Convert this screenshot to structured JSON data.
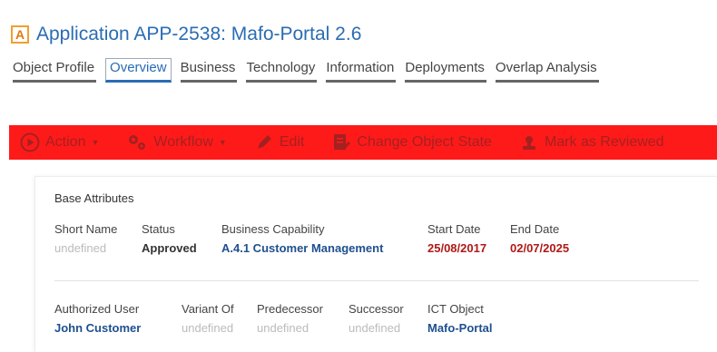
{
  "header": {
    "badge": "A",
    "title": "Application APP-2538: Mafo-Portal 2.6"
  },
  "tabs": [
    {
      "label": "Object Profile"
    },
    {
      "label": "Overview"
    },
    {
      "label": "Business"
    },
    {
      "label": "Technology"
    },
    {
      "label": "Information"
    },
    {
      "label": "Deployments"
    },
    {
      "label": "Overlap Analysis"
    }
  ],
  "toolbar": {
    "background": "#ff1a1a",
    "items": [
      {
        "label": "Action",
        "icon": "play-circle-icon"
      },
      {
        "label": "Workflow",
        "icon": "gears-icon"
      },
      {
        "label": "Edit",
        "icon": "pencil-icon"
      },
      {
        "label": "Change Object State",
        "icon": "document-edit-icon"
      },
      {
        "label": "Mark as Reviewed",
        "icon": "stamp-icon"
      }
    ]
  },
  "base_attributes": {
    "title": "Base Attributes",
    "row1": [
      {
        "label": "Short Name",
        "value": "undefined"
      },
      {
        "label": "Status",
        "value": "Approved"
      },
      {
        "label": "Business Capability",
        "value": "A.4.1 Customer Management"
      },
      {
        "label": "Start Date",
        "value": "25/08/2017"
      },
      {
        "label": "End Date",
        "value": "02/07/2025"
      }
    ],
    "row2": [
      {
        "label": "Authorized User",
        "value": "John Customer"
      },
      {
        "label": "Variant Of",
        "value": "undefined"
      },
      {
        "label": "Predecessor",
        "value": "undefined"
      },
      {
        "label": "Successor",
        "value": "undefined"
      },
      {
        "label": "ICT Object",
        "value": "Mafo-Portal"
      }
    ]
  }
}
